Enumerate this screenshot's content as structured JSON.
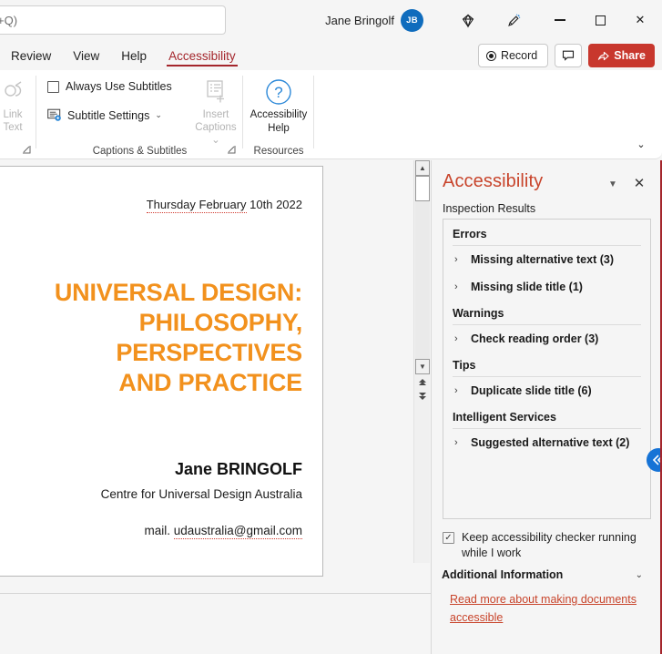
{
  "titlebar": {
    "search_value": "+Q)",
    "search_placeholder": "Search (Alt+Q)",
    "user_name": "Jane Bringolf",
    "user_initials": "JB",
    "diamond_icon": "diamond-icon",
    "ink_icon": "ink-pen-icon",
    "minimize_label": "Minimize",
    "maximize_label": "Maximize",
    "close_label": "Close"
  },
  "tabs": [
    {
      "label": "Review",
      "active": false
    },
    {
      "label": "View",
      "active": false
    },
    {
      "label": "Help",
      "active": false
    },
    {
      "label": "Accessibility",
      "active": true
    }
  ],
  "tab_actions": {
    "record_label": "Record",
    "comment_label": "Comments",
    "share_label": "Share"
  },
  "ribbon": {
    "link_text": {
      "label_line1": "Link",
      "label_line2": "Text",
      "icon": "link-text-icon",
      "enabled": false
    },
    "captions_group": {
      "group_label": "Captions & Subtitles",
      "always_use_subtitles": "Always Use Subtitles",
      "always_use_subtitles_checked": false,
      "subtitle_settings": "Subtitle Settings",
      "subtitle_settings_chevron": "⌄",
      "insert_captions_line1": "Insert",
      "insert_captions_line2": "Captions",
      "insert_captions_chevron": "⌄",
      "insert_captions_enabled": false
    },
    "resources_group": {
      "group_label": "Resources",
      "help_line1": "Accessibility",
      "help_line2": "Help",
      "help_icon": "question-circle-icon"
    },
    "collapse_chevron": "⌄"
  },
  "slide": {
    "date": "Thursday February",
    "date_rest": " 10th 2022",
    "title_lines": [
      "UNIVERSAL DESIGN:",
      "PHILOSOPHY,",
      "PERSPECTIVES",
      "AND PRACTICE"
    ],
    "title_color": "#F2911D",
    "author": "Jane BRINGOLF",
    "organisation": "Centre for Universal Design Australia",
    "mail_prefix": "mail. ",
    "mail": "udaustralia@gmail.com"
  },
  "scrollbar": {
    "up_arrow": "▲",
    "down_arrow": "▼",
    "prev_slide": "▲",
    "next_slide": "▼"
  },
  "accessibility_pane": {
    "title": "Accessibility",
    "caret": "▼",
    "close": "✕",
    "subtitle": "Inspection Results",
    "sections": [
      {
        "heading": "Errors",
        "items": [
          {
            "chevron": "›",
            "label": "Missing alternative text (3)"
          },
          {
            "chevron": "›",
            "label": "Missing slide title (1)"
          }
        ]
      },
      {
        "heading": "Warnings",
        "items": [
          {
            "chevron": "›",
            "label": "Check reading order (3)"
          }
        ]
      },
      {
        "heading": "Tips",
        "items": [
          {
            "chevron": "›",
            "label": "Duplicate slide title (6)"
          }
        ]
      },
      {
        "heading": "Intelligent Services",
        "items": [
          {
            "chevron": "›",
            "label": "Suggested alternative text (2)"
          }
        ]
      }
    ],
    "keep_running_label_line1": "Keep accessibility checker running",
    "keep_running_label_line2": "while I work",
    "keep_running_checked": true,
    "keep_running_check_glyph": "✓",
    "additional_information": "Additional Information",
    "additional_information_chevron": "⌄",
    "link_line1": "Read more about making documents",
    "link_line2": "accessible",
    "accent_color": "#C8442B"
  }
}
